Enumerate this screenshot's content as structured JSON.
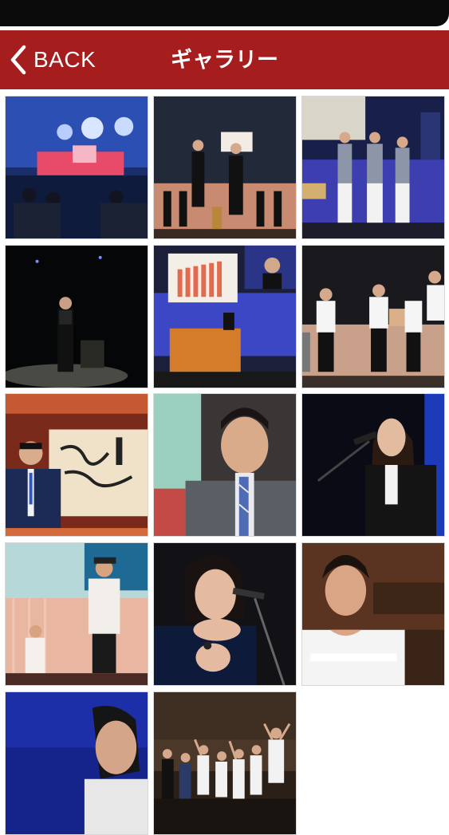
{
  "header": {
    "back_label": "BACK",
    "title": "ギャラリー",
    "back_icon": "chevron-left-icon",
    "bar_color": "#a51d1d"
  },
  "gallery": {
    "photos": [
      {
        "label": "concert-hall-stage-lights"
      },
      {
        "label": "speakers-holding-sign-on-stage"
      },
      {
        "label": "presenters-in-vests-on-stage"
      },
      {
        "label": "speaker-in-spotlight"
      },
      {
        "label": "podium-with-bar-chart-screen"
      },
      {
        "label": "group-with-white-shirts-on-stage"
      },
      {
        "label": "man-in-front-of-calligraphy-banner"
      },
      {
        "label": "man-speaking-closeup"
      },
      {
        "label": "woman-at-microphone"
      },
      {
        "label": "performer-in-white-jacket"
      },
      {
        "label": "woman-smiling-at-microphone"
      },
      {
        "label": "man-in-broche-shirt"
      },
      {
        "label": "man-on-blue-background"
      },
      {
        "label": "group-celebrating-on-stage"
      }
    ]
  }
}
